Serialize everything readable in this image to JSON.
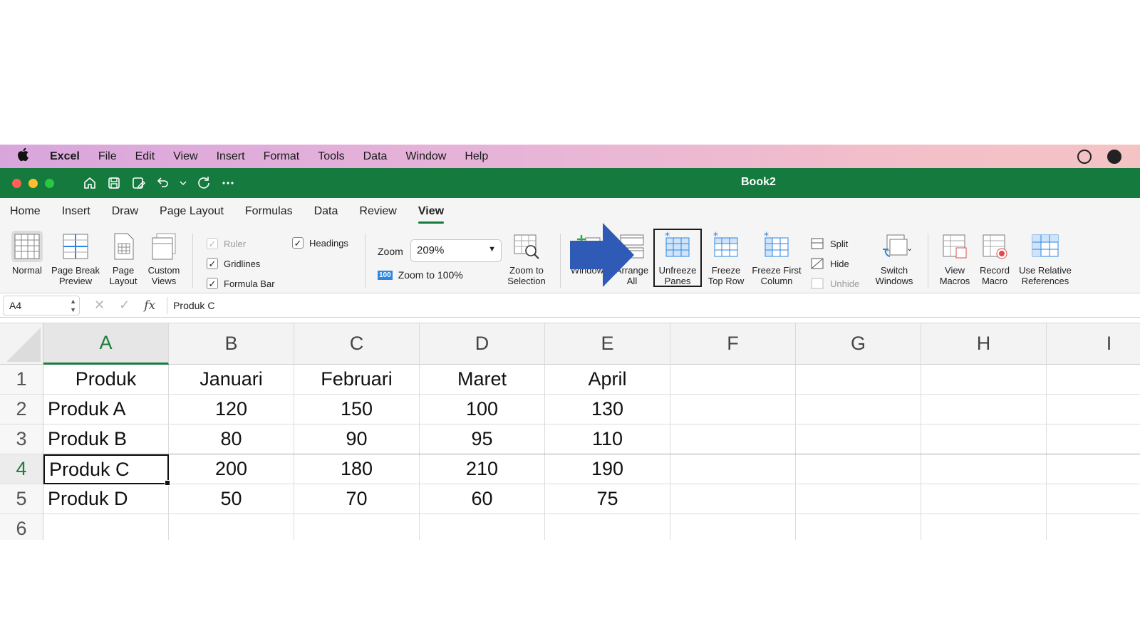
{
  "menubar": {
    "items": [
      "Excel",
      "File",
      "Edit",
      "View",
      "Insert",
      "Format",
      "Tools",
      "Data",
      "Window",
      "Help"
    ]
  },
  "window": {
    "title": "Book2"
  },
  "tabs": [
    "Home",
    "Insert",
    "Draw",
    "Page Layout",
    "Formulas",
    "Data",
    "Review",
    "View"
  ],
  "active_tab": "View",
  "ribbon": {
    "views": {
      "normal": "Normal",
      "page_break_1": "Page Break",
      "page_break_2": "Preview",
      "page_layout_1": "Page",
      "page_layout_2": "Layout",
      "custom_1": "Custom",
      "custom_2": "Views"
    },
    "show": {
      "ruler": "Ruler",
      "headings": "Headings",
      "gridlines": "Gridlines",
      "formula_bar": "Formula Bar",
      "ruler_checked": true,
      "headings_checked": true,
      "gridlines_checked": true,
      "formula_bar_checked": true
    },
    "zoom": {
      "label": "Zoom",
      "value": "209%",
      "badge": "100",
      "to100": "Zoom to 100%",
      "selection_1": "Zoom to",
      "selection_2": "Selection"
    },
    "window": {
      "new_window": "Window",
      "arrange_1": "Arrange",
      "arrange_2": "All",
      "unfreeze_1": "Unfreeze",
      "unfreeze_2": "Panes",
      "freeze_top_1": "Freeze",
      "freeze_top_2": "Top Row",
      "freeze_first_1": "Freeze First",
      "freeze_first_2": "Column",
      "split": "Split",
      "hide": "Hide",
      "unhide": "Unhide",
      "switch_1": "Switch",
      "switch_2": "Windows"
    },
    "macros": {
      "view_1": "View",
      "view_2": "Macros",
      "record_1": "Record",
      "record_2": "Macro",
      "relative_1": "Use Relative",
      "relative_2": "References"
    }
  },
  "formula_bar": {
    "name_box": "A4",
    "fx": "fx",
    "value": "Produk C"
  },
  "sheet": {
    "columns": [
      "A",
      "B",
      "C",
      "D",
      "E",
      "F",
      "G",
      "H",
      "I"
    ],
    "rows": [
      "1",
      "2",
      "3",
      "4",
      "5",
      "6"
    ],
    "cells": [
      [
        "Produk",
        "Januari",
        "Februari",
        "Maret",
        "April"
      ],
      [
        "Produk A",
        "120",
        "150",
        "100",
        "130"
      ],
      [
        "Produk B",
        "80",
        "90",
        "95",
        "110"
      ],
      [
        "Produk C",
        "200",
        "180",
        "210",
        "190"
      ],
      [
        "Produk D",
        "50",
        "70",
        "60",
        "75"
      ],
      [
        "",
        "",
        "",
        "",
        ""
      ]
    ],
    "active_cell": "A4"
  },
  "colors": {
    "accent_green": "#147a3e",
    "arrow_blue": "#2f5bb7",
    "menubar_left": "#d9a6dc",
    "menubar_right": "#f4c4c4"
  }
}
